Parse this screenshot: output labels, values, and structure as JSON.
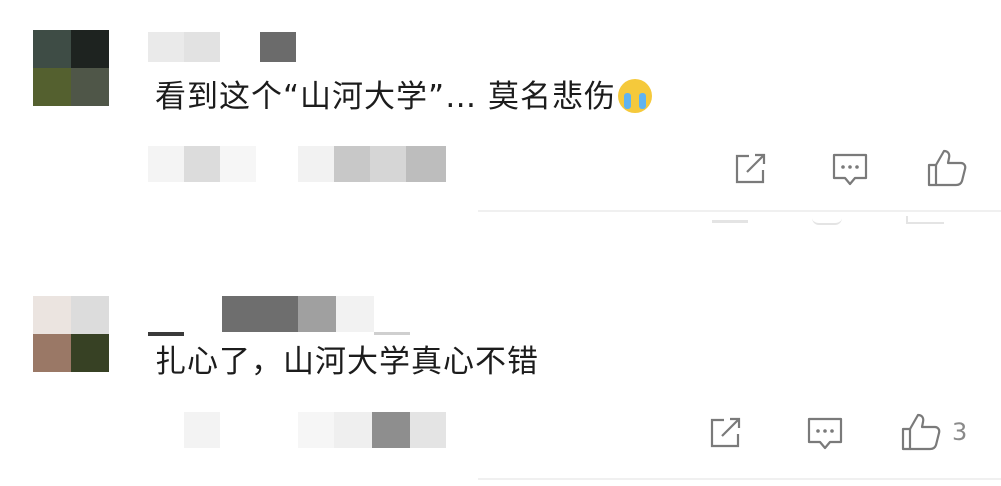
{
  "comments": [
    {
      "text": "看到这个“山河大学”… 莫名悲伤",
      "emoji": "loudly-crying-face",
      "likes": ""
    },
    {
      "text": "扎心了，山河大学真心不错",
      "likes": "3"
    }
  ],
  "colors": {
    "text": "#1c1c1c",
    "icon": "#7a7a7a",
    "divider": "#f0f0f0"
  },
  "icons": [
    "share-icon",
    "reply-icon",
    "like-icon",
    "loudly-crying-emoji-icon"
  ]
}
